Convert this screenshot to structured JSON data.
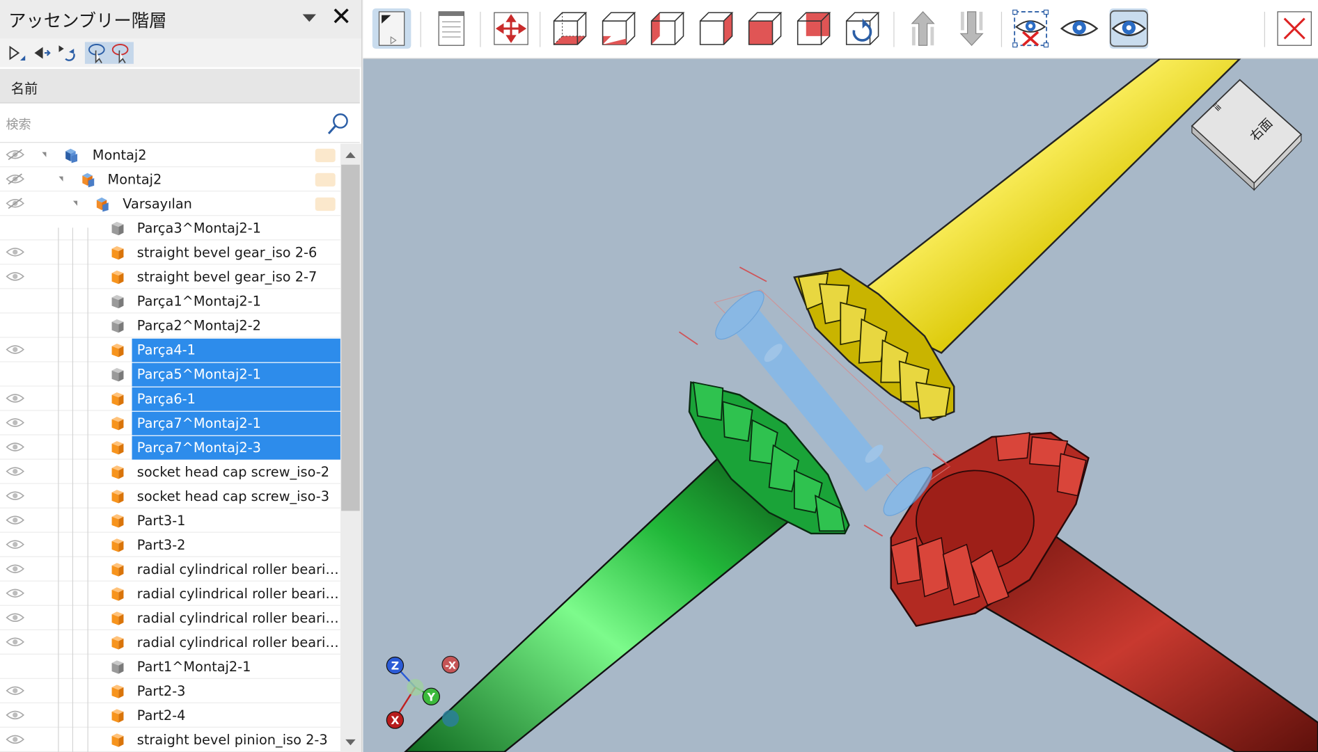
{
  "panel": {
    "title": "アッセンブリー階層",
    "close": "✕",
    "column_header": "名前",
    "search_placeholder": "検索"
  },
  "tree": [
    {
      "label": "Montaj2",
      "level": 0,
      "icon": "assembly",
      "eye": "hidden",
      "expanded": true,
      "selected": false
    },
    {
      "label": "Montaj2",
      "level": 1,
      "icon": "assembly",
      "eye": "hidden",
      "expanded": true,
      "selected": false
    },
    {
      "label": "Varsayılan",
      "level": 2,
      "icon": "assembly",
      "eye": "hidden",
      "expanded": true,
      "selected": false
    },
    {
      "label": "Parça3^Montaj2-1",
      "level": 3,
      "icon": "gray-part",
      "eye": "none",
      "selected": false
    },
    {
      "label": "straight bevel gear_iso 2-6",
      "level": 3,
      "icon": "orange-part",
      "eye": "visible",
      "selected": false
    },
    {
      "label": "straight bevel gear_iso 2-7",
      "level": 3,
      "icon": "orange-part",
      "eye": "visible",
      "selected": false
    },
    {
      "label": "Parça1^Montaj2-1",
      "level": 3,
      "icon": "gray-part",
      "eye": "none",
      "selected": false
    },
    {
      "label": "Parça2^Montaj2-2",
      "level": 3,
      "icon": "gray-part",
      "eye": "none",
      "selected": false
    },
    {
      "label": "Parça4-1",
      "level": 3,
      "icon": "orange-part",
      "eye": "visible",
      "selected": true
    },
    {
      "label": "Parça5^Montaj2-1",
      "level": 3,
      "icon": "gray-part",
      "eye": "none",
      "selected": true
    },
    {
      "label": "Parça6-1",
      "level": 3,
      "icon": "orange-part",
      "eye": "visible",
      "selected": true
    },
    {
      "label": "Parça7^Montaj2-1",
      "level": 3,
      "icon": "orange-part",
      "eye": "visible",
      "selected": true
    },
    {
      "label": "Parça7^Montaj2-3",
      "level": 3,
      "icon": "orange-part",
      "eye": "visible",
      "selected": true
    },
    {
      "label": "socket head cap screw_iso-2",
      "level": 3,
      "icon": "orange-part",
      "eye": "visible",
      "selected": false
    },
    {
      "label": "socket head cap screw_iso-3",
      "level": 3,
      "icon": "orange-part",
      "eye": "visible",
      "selected": false
    },
    {
      "label": "Part3-1",
      "level": 3,
      "icon": "orange-part",
      "eye": "visible",
      "selected": false
    },
    {
      "label": "Part3-2",
      "level": 3,
      "icon": "orange-part",
      "eye": "visible",
      "selected": false
    },
    {
      "label": "radial cylindrical roller beari…",
      "level": 3,
      "icon": "orange-part",
      "eye": "visible",
      "selected": false
    },
    {
      "label": "radial cylindrical roller beari…",
      "level": 3,
      "icon": "orange-part",
      "eye": "visible",
      "selected": false
    },
    {
      "label": "radial cylindrical roller beari…",
      "level": 3,
      "icon": "orange-part",
      "eye": "visible",
      "selected": false
    },
    {
      "label": "radial cylindrical roller beari…",
      "level": 3,
      "icon": "orange-part",
      "eye": "visible",
      "selected": false
    },
    {
      "label": "Part1^Montaj2-1",
      "level": 3,
      "icon": "gray-part",
      "eye": "none",
      "selected": false
    },
    {
      "label": "Part2-3",
      "level": 3,
      "icon": "orange-part",
      "eye": "visible",
      "selected": false
    },
    {
      "label": "Part2-4",
      "level": 3,
      "icon": "orange-part",
      "eye": "visible",
      "selected": false
    },
    {
      "label": "straight bevel pinion_iso 2-3",
      "level": 3,
      "icon": "orange-part",
      "eye": "visible",
      "selected": false
    }
  ],
  "toolbar": {
    "buttons": [
      {
        "name": "sheet-layout-icon",
        "active": true
      },
      {
        "name": "document-icon",
        "active": false
      },
      {
        "name": "fit-all-icon",
        "active": false
      },
      {
        "name": "view-bottom-icon",
        "active": false
      },
      {
        "name": "view-front-icon",
        "active": false
      },
      {
        "name": "view-left-icon",
        "active": false
      },
      {
        "name": "view-right-icon",
        "active": false
      },
      {
        "name": "view-back-icon",
        "active": false
      },
      {
        "name": "view-top-icon",
        "active": false
      },
      {
        "name": "rotate-view-icon",
        "active": false
      },
      {
        "name": "move-up-icon",
        "active": false
      },
      {
        "name": "move-down-icon",
        "active": false
      },
      {
        "name": "hide-selected-icon",
        "active": false
      },
      {
        "name": "show-icon",
        "active": false
      },
      {
        "name": "show-all-icon",
        "active": true
      },
      {
        "name": "close-view-icon",
        "active": false
      }
    ]
  },
  "viewport": {
    "viewcube_label": "右面",
    "viewcube_top_label": "ⅲ",
    "triad": {
      "z": "Z",
      "y": "Y",
      "x": "X",
      "neg_x": "-X"
    }
  },
  "colors": {
    "selection": "#2d8ceb",
    "background": "#a8b8c8",
    "yellow_shaft": "#e4d200",
    "green_shaft": "#22b83a",
    "red_shaft": "#b02a22",
    "selected_part": "#7fb8ee"
  }
}
